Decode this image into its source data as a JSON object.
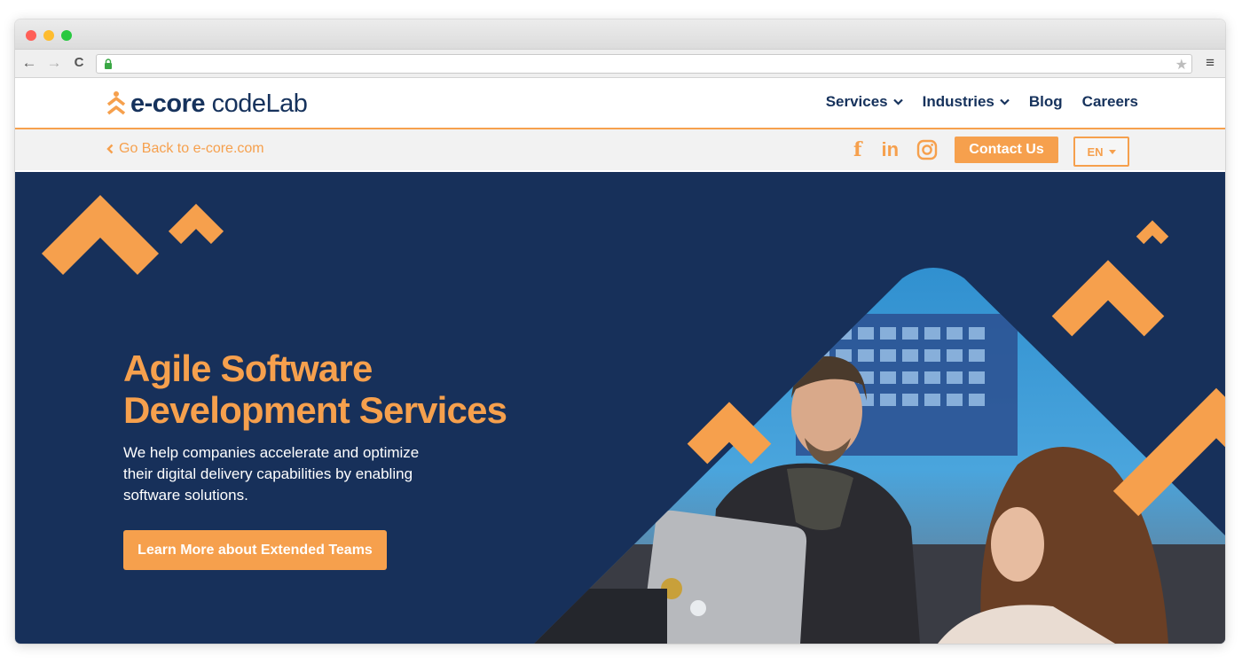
{
  "browser": {
    "address": "",
    "back_icon": "←",
    "forward_icon": "→",
    "reload_icon": "C",
    "star_icon": "★",
    "menu_icon": "≡"
  },
  "header": {
    "logo_bold": "e-core",
    "logo_light": " codeLab",
    "nav": [
      {
        "label": "Services",
        "dropdown": true
      },
      {
        "label": "Industries",
        "dropdown": true
      },
      {
        "label": "Blog",
        "dropdown": false
      },
      {
        "label": "Careers",
        "dropdown": false
      }
    ]
  },
  "subbar": {
    "back_link": "Go Back to e-core.com",
    "social": [
      "facebook-icon",
      "linkedin-icon",
      "instagram-icon"
    ],
    "facebook_glyph": "f",
    "linkedin_glyph": "in",
    "contact_label": "Contact Us",
    "language": "EN"
  },
  "hero": {
    "title_line1": "Agile Software",
    "title_line2": "Development Services",
    "subtitle": "We help companies accelerate and optimize their digital delivery capabilities by enabling software solutions.",
    "cta_label": "Learn More about Extended Teams"
  },
  "colors": {
    "accent": "#f6a04d",
    "navy": "#17305a",
    "brand_text": "#16325c"
  }
}
